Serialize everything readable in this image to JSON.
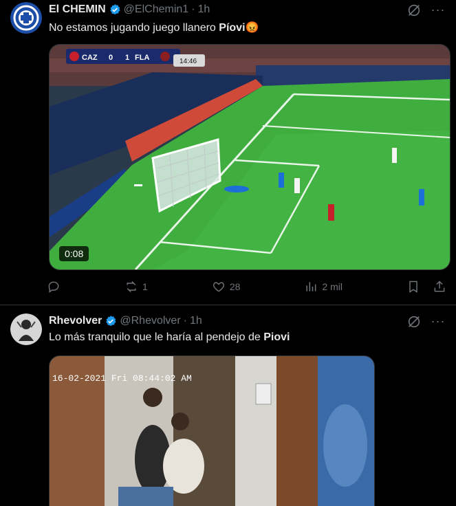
{
  "tweets": [
    {
      "name": "El CHEMIN",
      "handle": "@ElChemin1",
      "sep": "·",
      "time": "1h",
      "text_before": "No estamos jugando juego llanero ",
      "text_bold": "Píovi",
      "emoji": "😡",
      "video_time": "0:08",
      "scorebug": {
        "home": "CAZ",
        "home_score": "0",
        "away_score": "1",
        "away": "FLA",
        "clock": "14:46"
      },
      "actions": {
        "reply": "",
        "retweet": "1",
        "like": "28",
        "views": "2 mil"
      }
    },
    {
      "name": "Rhevolver",
      "handle": "@Rhevolver",
      "sep": "·",
      "time": "1h",
      "text_before": "Lo más tranquilo que le haría al pendejo de ",
      "text_bold": "Piovi",
      "cctv_stamp": "16-02-2021 Fri 08:44:02 AM"
    }
  ],
  "colors": {
    "verified": "#1d9bf0",
    "muted": "#71767b",
    "text": "#e7e9ea",
    "pitch": "#3fae3f"
  },
  "icons": [
    "verified-icon",
    "grok-icon",
    "more-icon",
    "reply-icon",
    "retweet-icon",
    "like-icon",
    "views-icon",
    "bookmark-icon",
    "share-icon"
  ]
}
